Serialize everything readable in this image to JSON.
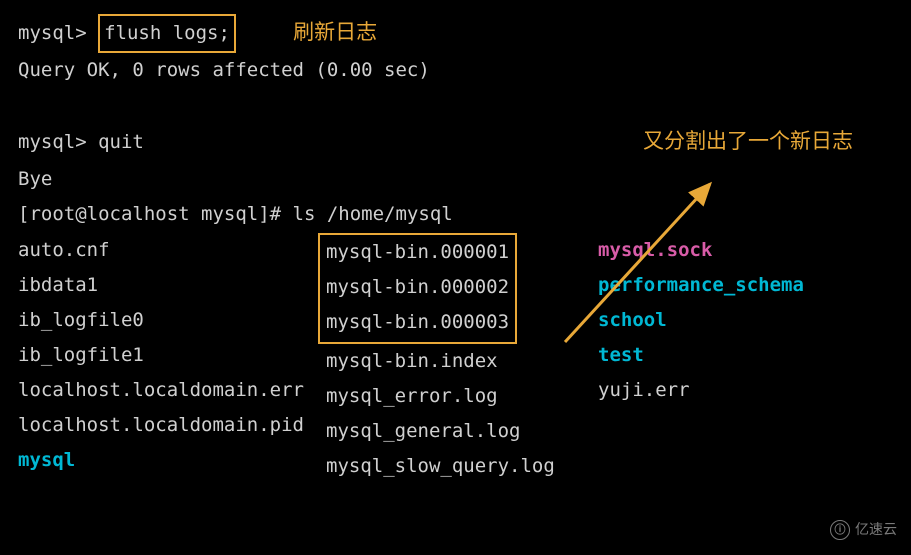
{
  "prompt1": "mysql> ",
  "cmd1": "flush logs;",
  "note1": "刷新日志",
  "result1": "Query OK, 0 rows affected (0.00 sec)",
  "prompt2": "mysql> ",
  "cmd2": "quit",
  "note2": "又分割出了一个新日志",
  "bye": "Bye",
  "shellPrompt": "[root@localhost mysql]# ",
  "shellCmd": "ls /home/mysql",
  "files": {
    "col1": [
      "auto.cnf",
      "ibdata1",
      "ib_logfile0",
      "ib_logfile1",
      "localhost.localdomain.err",
      "localhost.localdomain.pid",
      "mysql"
    ],
    "col2_boxed": [
      "mysql-bin.000001",
      "mysql-bin.000002",
      "mysql-bin.000003"
    ],
    "col2_rest": [
      "mysql-bin.index",
      "mysql_error.log",
      "mysql_general.log",
      "mysql_slow_query.log"
    ],
    "col3": [
      "mysql.sock",
      "performance_schema",
      "school",
      "test",
      "yuji.err"
    ]
  },
  "watermark": "亿速云"
}
